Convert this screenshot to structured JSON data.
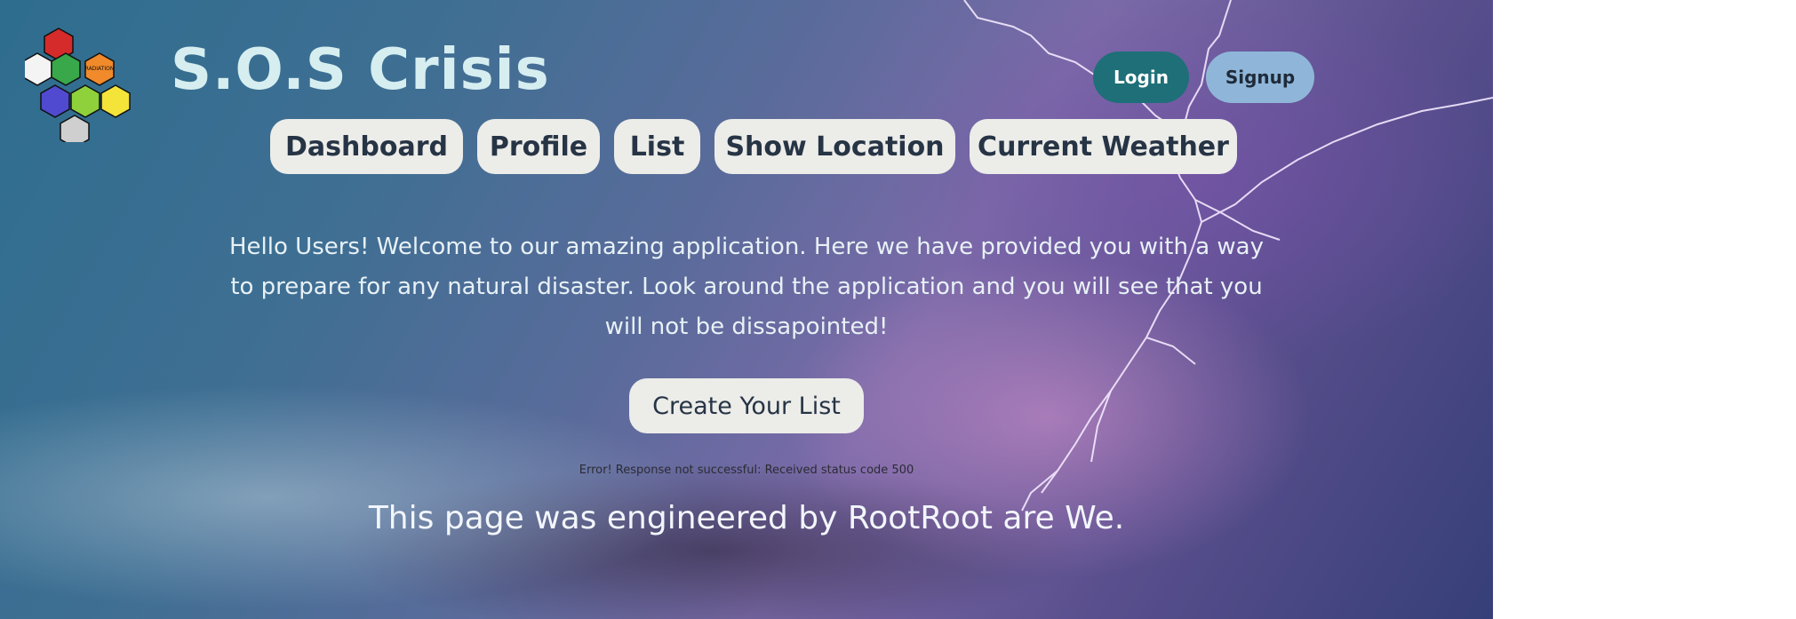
{
  "header": {
    "brand": "S.O.S Crisis",
    "login_label": "Login",
    "signup_label": "Signup"
  },
  "nav": {
    "items": [
      {
        "label": "Dashboard"
      },
      {
        "label": "Profile"
      },
      {
        "label": "List"
      },
      {
        "label": "Show Location"
      },
      {
        "label": "Current Weather"
      }
    ]
  },
  "main": {
    "welcome": "Hello Users! Welcome to our amazing application. Here we have provided you with a way to prepare for any natural disaster. Look around the application and you will see that you will not be dissapointed!",
    "create_label": "Create Your List",
    "error": "Error! Response not successful: Received status code 500",
    "footer": "This page was engineered by RootRoot are We."
  },
  "logo": {
    "badge_text": "RADIATION",
    "icons": [
      "fire-icon",
      "radiation-icon",
      "fire-person-icon",
      "toxic-icon",
      "biohazard-icon",
      "medical-icon",
      "handshake-icon",
      "storm-cloud-icon"
    ]
  },
  "colors": {
    "login_bg": "#1e6f78",
    "signup_bg": "#8fb6d8",
    "button_bg": "#ecece9",
    "button_text": "#263445",
    "brand_text": "#d6eef0"
  }
}
